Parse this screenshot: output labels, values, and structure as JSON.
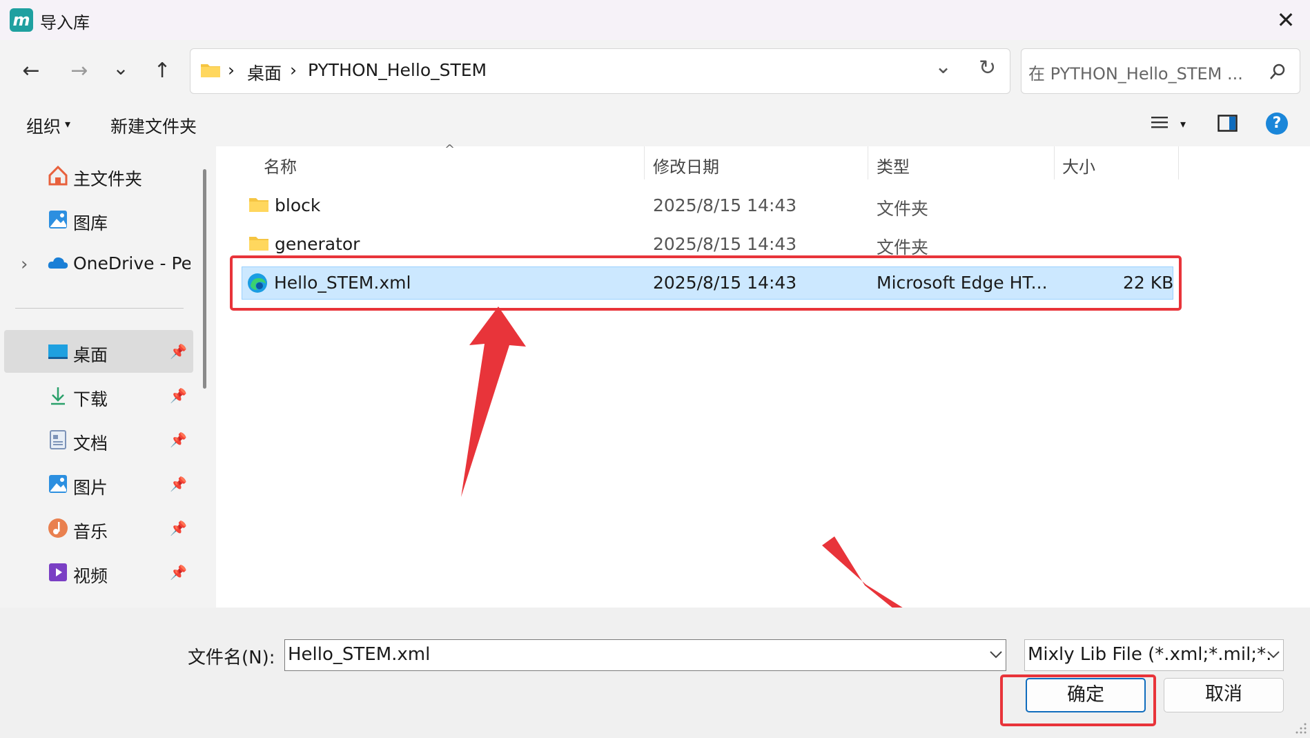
{
  "window": {
    "title": "导入库",
    "logo_text": "m",
    "close_glyph": "✕"
  },
  "nav": {
    "back": "←",
    "forward": "→",
    "recent": "⌄",
    "up": "↑"
  },
  "address": {
    "breadcrumbs": [
      "桌面",
      "PYTHON_Hello_STEM"
    ],
    "separator": "›",
    "dropdown": "⌄",
    "refresh": "↻"
  },
  "search": {
    "placeholder": "在 PYTHON_Hello_STEM ...",
    "icon": "⚲"
  },
  "toolbar": {
    "organize": "组织",
    "organize_arrow": "▾",
    "new_folder": "新建文件夹",
    "view_arrow": "▾",
    "help": "?"
  },
  "sidebar": {
    "items": [
      {
        "label": "主文件夹",
        "icon": "home-icon"
      },
      {
        "label": "图库",
        "icon": "gallery-icon"
      },
      {
        "label": "OneDrive - Per",
        "icon": "onedrive-icon",
        "expand": "›"
      },
      {
        "label": "桌面",
        "icon": "desktop-icon",
        "pinned": true
      },
      {
        "label": "下载",
        "icon": "download-icon",
        "pinned": true
      },
      {
        "label": "文档",
        "icon": "document-icon",
        "pinned": true
      },
      {
        "label": "图片",
        "icon": "pictures-icon",
        "pinned": true
      },
      {
        "label": "音乐",
        "icon": "music-icon",
        "pinned": true
      },
      {
        "label": "视频",
        "icon": "video-icon",
        "pinned": true
      }
    ],
    "pin_glyph": "📌"
  },
  "columns": {
    "name": "名称",
    "modified": "修改日期",
    "type": "类型",
    "size": "大小",
    "sort_glyph": "^"
  },
  "files": [
    {
      "name": "block",
      "modified": "2025/8/15 14:43",
      "type": "文件夹",
      "size": "",
      "icon": "folder-icon"
    },
    {
      "name": "generator",
      "modified": "2025/8/15 14:43",
      "type": "文件夹",
      "size": "",
      "icon": "folder-icon"
    },
    {
      "name": "Hello_STEM.xml",
      "modified": "2025/8/15 14:43",
      "type": "Microsoft Edge HT...",
      "size": "22 KB",
      "icon": "edge-icon",
      "selected": true
    }
  ],
  "footer": {
    "filename_label": "文件名(N):",
    "filename_value": "Hello_STEM.xml",
    "filter_value": "Mixly Lib File (*.xml;*.mil;*.",
    "ok": "确定",
    "cancel": "取消"
  },
  "colors": {
    "selection": "#cce8ff",
    "selection_border": "#99d1ff",
    "annotation": "#e8343a",
    "accent": "#0f6cbd"
  }
}
